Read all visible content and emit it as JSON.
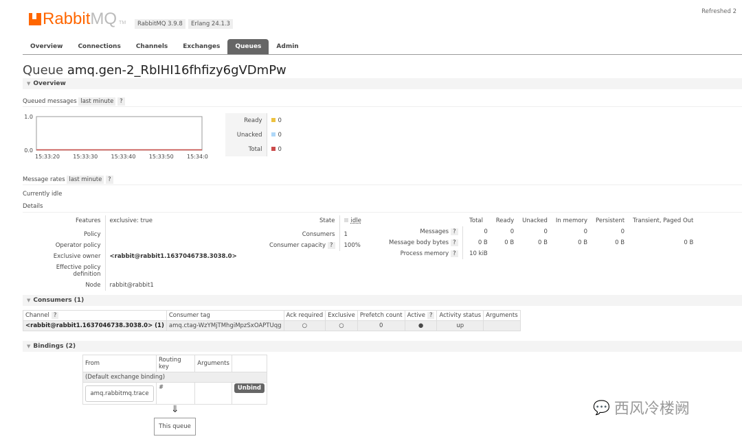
{
  "header": {
    "logo": "RabbitMQ",
    "logo_tm": "TM",
    "version": "RabbitMQ 3.9.8",
    "erlang": "Erlang 24.1.3",
    "refreshed": "Refreshed 2"
  },
  "nav": {
    "tabs": [
      "Overview",
      "Connections",
      "Channels",
      "Exchanges",
      "Queues",
      "Admin"
    ],
    "active": "Queues"
  },
  "page": {
    "title_prefix": "Queue",
    "queue_name": "amq.gen-2_RbIHI16fhfizy6gVDmPw"
  },
  "overview": {
    "section": "Overview",
    "queued_label": "Queued messages",
    "range": "last minute",
    "help": "?",
    "rates_label": "Message rates",
    "idle": "Currently idle",
    "details": "Details"
  },
  "chart_data": {
    "type": "line",
    "x": [
      "15:33:20",
      "15:33:30",
      "15:33:40",
      "15:33:50",
      "15:34:00"
    ],
    "ylim": [
      0,
      1
    ],
    "yticks": [
      "0.0",
      "1.0"
    ],
    "series": [
      {
        "name": "Ready",
        "values": [
          0,
          0,
          0,
          0,
          0
        ],
        "color": "#edc240"
      },
      {
        "name": "Unacked",
        "values": [
          0,
          0,
          0,
          0,
          0
        ],
        "color": "#afd8f8"
      },
      {
        "name": "Total",
        "values": [
          0,
          0,
          0,
          0,
          0
        ],
        "color": "#cb4b4b"
      }
    ],
    "legend_values": [
      "0",
      "0",
      "0"
    ]
  },
  "details": {
    "left": [
      {
        "k": "Features",
        "v": "exclusive:",
        "v2": "true"
      },
      {
        "k": "Policy",
        "v": ""
      },
      {
        "k": "Operator policy",
        "v": ""
      },
      {
        "k": "Exclusive owner",
        "v": "<rabbit@rabbit1.1637046738.3038.0>"
      },
      {
        "k": "Effective policy definition",
        "v": ""
      },
      {
        "k": "Node",
        "v": "rabbit@rabbit1"
      }
    ],
    "mid": [
      {
        "k": "State",
        "v": "idle"
      },
      {
        "k": "Consumers",
        "v": "1"
      },
      {
        "k": "Consumer capacity",
        "v": "100%"
      }
    ],
    "stats_headers": [
      "Total",
      "Ready",
      "Unacked",
      "In memory",
      "Persistent",
      "Transient, Paged Out"
    ],
    "stats": [
      {
        "k": "Messages",
        "vals": [
          "0",
          "0",
          "0",
          "0",
          "0",
          ""
        ]
      },
      {
        "k": "Message body bytes",
        "vals": [
          "0 B",
          "0 B",
          "0 B",
          "0 B",
          "0 B",
          "0 B"
        ]
      },
      {
        "k": "Process memory",
        "vals": [
          "10 kiB",
          "",
          "",
          "",
          "",
          ""
        ]
      }
    ]
  },
  "consumers": {
    "section": "Consumers (1)",
    "headers": [
      "Channel",
      "Consumer tag",
      "Ack required",
      "Exclusive",
      "Prefetch count",
      "Active",
      "Activity status",
      "Arguments"
    ],
    "row": {
      "channel": "<rabbit@rabbit1.1637046738.3038.0> (1)",
      "tag": "amq.ctag-WzYMjTMhgiMpzSxOAPTUqg",
      "ack": "○",
      "exclusive": "○",
      "prefetch": "0",
      "active": "●",
      "status": "up",
      "args": ""
    }
  },
  "bindings": {
    "section": "Bindings (2)",
    "headers": [
      "From",
      "Routing key",
      "Arguments"
    ],
    "default": "(Default exchange binding)",
    "row": {
      "from": "amq.rabbitmq.trace",
      "key": "#",
      "args": "",
      "unbind": "Unbind"
    },
    "arrow": "⇓",
    "this_queue": "This queue"
  },
  "watermark": "西风冷楼阙"
}
